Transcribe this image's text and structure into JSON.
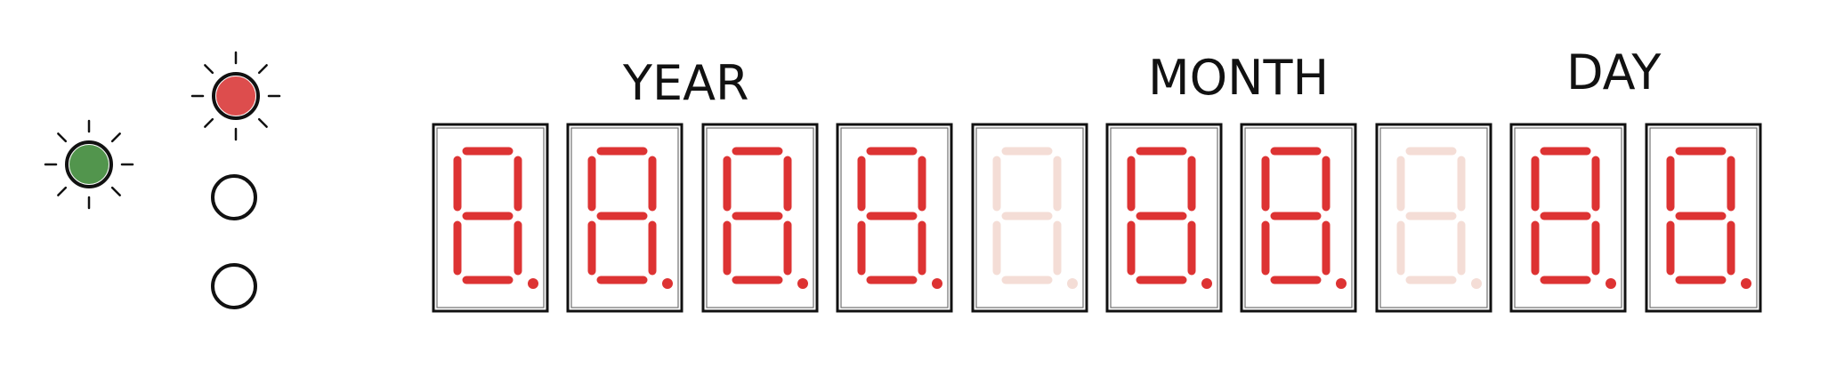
{
  "labels": {
    "year": "YEAR",
    "month": "MONTH",
    "day": "DAY"
  },
  "lights": [
    {
      "name": "green-indicator",
      "state": "on",
      "color": "#3f8a3a"
    },
    {
      "name": "red-indicator",
      "state": "on",
      "color": "#d93a3a"
    },
    {
      "name": "indicator-3",
      "state": "off"
    },
    {
      "name": "indicator-4",
      "state": "off"
    }
  ],
  "digits": [
    {
      "group": "year",
      "state": "on"
    },
    {
      "group": "year",
      "state": "on"
    },
    {
      "group": "year",
      "state": "on"
    },
    {
      "group": "year",
      "state": "on"
    },
    {
      "group": "separator",
      "state": "dim"
    },
    {
      "group": "month",
      "state": "on"
    },
    {
      "group": "month",
      "state": "on"
    },
    {
      "group": "separator",
      "state": "dim"
    },
    {
      "group": "day",
      "state": "on"
    },
    {
      "group": "day",
      "state": "on"
    }
  ],
  "colors": {
    "segment_on": "#dd3333",
    "segment_dim": "#f4ddd6",
    "outline": "#111111"
  }
}
